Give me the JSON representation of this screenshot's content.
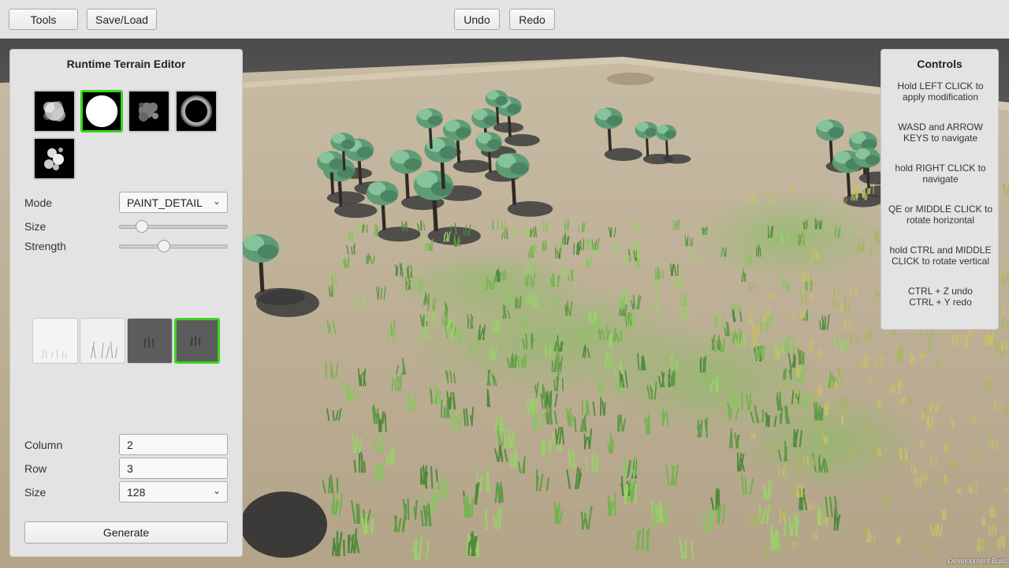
{
  "toolbar": {
    "tools_label": "Tools",
    "saveload_label": "Save/Load",
    "undo_label": "Undo",
    "redo_label": "Redo"
  },
  "editor": {
    "title": "Runtime Terrain Editor",
    "brushes": [
      "cloud-brush",
      "circle-brush",
      "noise-brush",
      "ring-brush",
      "scatter-brush"
    ],
    "selected_brush": 1,
    "mode_label": "Mode",
    "mode_value": "PAINT_DETAIL",
    "size_label": "Size",
    "size_level": 0.17,
    "strength_label": "Strength",
    "strength_level": 0.4,
    "details": [
      "grass-white-detail",
      "grass-sparse-detail",
      "grass-dark-detail",
      "grass-dark-selected-detail"
    ],
    "selected_detail": 3,
    "column_label": "Column",
    "column_value": "2",
    "row_label": "Row",
    "row_value": "3",
    "terrain_size_label": "Size",
    "terrain_size_value": "128",
    "generate_label": "Generate"
  },
  "controls": {
    "title": "Controls",
    "items": [
      "Hold LEFT CLICK to apply modification",
      "WASD and ARROW KEYS to navigate",
      "hold RIGHT CLICK to navigate",
      "QE or MIDDLE CLICK to rotate horizontal",
      "hold CTRL and MIDDLE CLICK to rotate vertical",
      "CTRL + Z undo CTRL + Y redo"
    ]
  },
  "footer": {
    "build_label": "Development Build"
  },
  "colors": {
    "accent_selected": "#3cd21e",
    "panel_bg": "#e3e3e3",
    "terrain": "#b9ab93"
  }
}
